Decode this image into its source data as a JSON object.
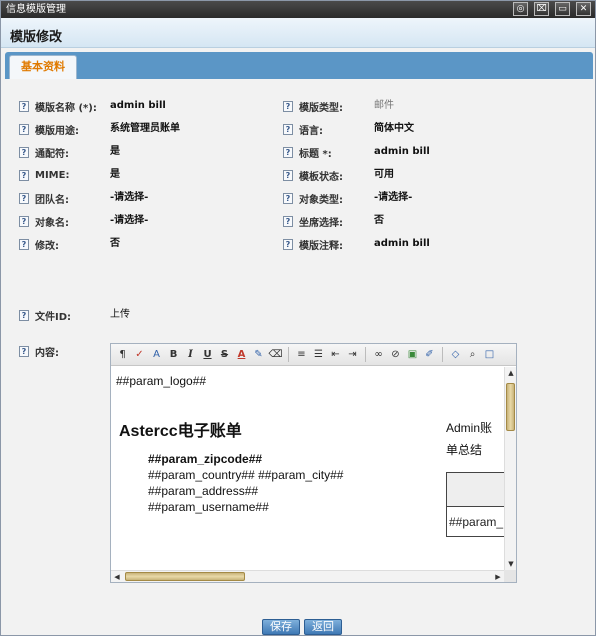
{
  "window": {
    "title": "信息模版管理",
    "controls": [
      "◎",
      "⌧",
      "▭",
      "✕"
    ]
  },
  "header": {
    "title": "模版修改"
  },
  "tabs": [
    {
      "label": "基本资料",
      "active": true
    }
  ],
  "help_icon_glyph": "?",
  "fields_left": [
    {
      "label": "模版名称 (*):",
      "value": "admin bill",
      "style": "bold"
    },
    {
      "label": "模版用途:",
      "value": "系统管理员账单",
      "style": "bold"
    },
    {
      "label": "通配符:",
      "value": "是",
      "style": "bold"
    },
    {
      "label": "MIME:",
      "value": "是",
      "style": "bold"
    },
    {
      "label": "团队名:",
      "value": "-请选择-",
      "style": "bold"
    },
    {
      "label": "对象名:",
      "value": "-请选择-",
      "style": "bold"
    },
    {
      "label": "修改:",
      "value": "否",
      "style": "bold"
    }
  ],
  "fields_right": [
    {
      "label": "模版类型:",
      "value": "邮件",
      "style": "grey"
    },
    {
      "label": "语言:",
      "value": "简体中文",
      "style": "bold"
    },
    {
      "label": "标题 *:",
      "value": "admin bill",
      "style": "bold"
    },
    {
      "label": "模板状态:",
      "value": "可用",
      "style": "bold"
    },
    {
      "label": "对象类型:",
      "value": "-请选择-",
      "style": "bold"
    },
    {
      "label": "坐席选择:",
      "value": "否",
      "style": "bold"
    },
    {
      "label": "模版注释:",
      "value": "admin bill",
      "style": "bold"
    }
  ],
  "file_id": {
    "label": "文件ID:",
    "value": "上传"
  },
  "content_label": "内容:",
  "editor": {
    "toolbar": [
      {
        "name": "format-paragraph-icon",
        "glyph": "¶"
      },
      {
        "name": "spellcheck-icon",
        "glyph": "✓"
      },
      {
        "name": "font-style-icon",
        "glyph": "A"
      },
      {
        "name": "bold-icon",
        "glyph": "B"
      },
      {
        "name": "italic-icon",
        "glyph": "I"
      },
      {
        "name": "underline-icon",
        "glyph": "U"
      },
      {
        "name": "strikethrough-icon",
        "glyph": "S"
      },
      {
        "name": "font-color-icon",
        "glyph": "A"
      },
      {
        "name": "highlight-icon",
        "glyph": "✎"
      },
      {
        "name": "eraser-icon",
        "glyph": "⌫"
      },
      {
        "name": "align-left-icon",
        "glyph": "≡"
      },
      {
        "name": "bullet-list-icon",
        "glyph": "☰"
      },
      {
        "name": "outdent-icon",
        "glyph": "⇤"
      },
      {
        "name": "indent-icon",
        "glyph": "⇥"
      },
      {
        "name": "link-icon",
        "glyph": "∞"
      },
      {
        "name": "unlink-icon",
        "glyph": "⊘"
      },
      {
        "name": "image-icon",
        "glyph": "▣"
      },
      {
        "name": "edit-icon",
        "glyph": "✐"
      },
      {
        "name": "source-code-icon",
        "glyph": "◇"
      },
      {
        "name": "preview-icon",
        "glyph": "⌕"
      },
      {
        "name": "fullscreen-icon",
        "glyph": "□"
      }
    ],
    "content": {
      "logo": "##param_logo##",
      "title": "Astercc电子账单",
      "zipcode": "##param_zipcode##",
      "country_city": "##param_country## ##param_city##",
      "address": "##param_address##",
      "username": "##param_username##",
      "summary_line1": "Admin账",
      "summary_line2": "单总结",
      "table_cell": "##param_"
    },
    "vscroll": {
      "up": "▲",
      "down": "▼"
    },
    "hscroll": {
      "left": "◀",
      "right": "▶"
    }
  },
  "buttons": {
    "save": "保存",
    "back": "返回"
  }
}
